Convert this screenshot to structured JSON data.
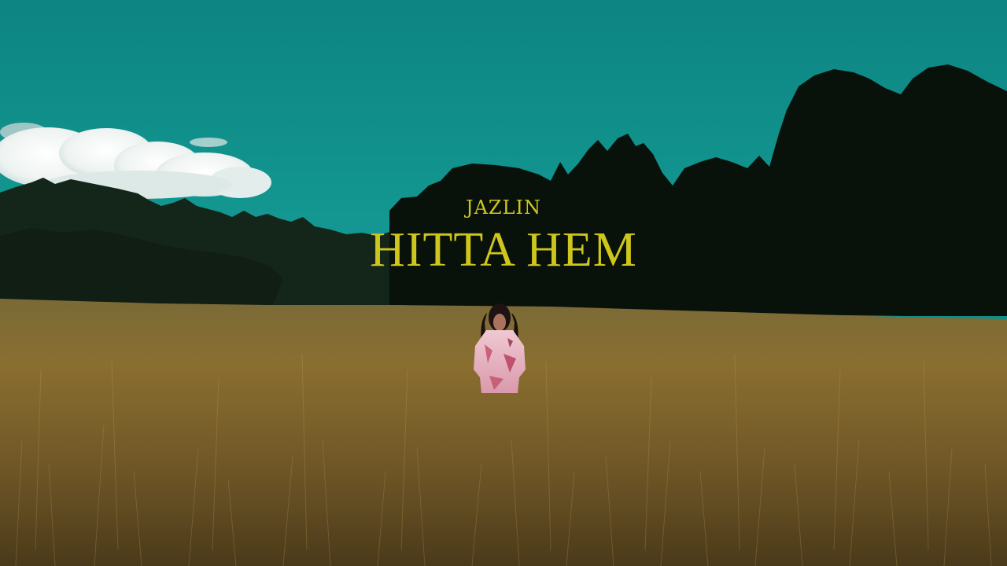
{
  "title": {
    "artist": "JAZLIN",
    "song": "HITTA HEM"
  },
  "colors": {
    "sky": "#0f8d89",
    "title": "#cfc61d",
    "trees": "#0b1a10",
    "field": "#8b6d30",
    "dress": "#e6b7c6"
  }
}
